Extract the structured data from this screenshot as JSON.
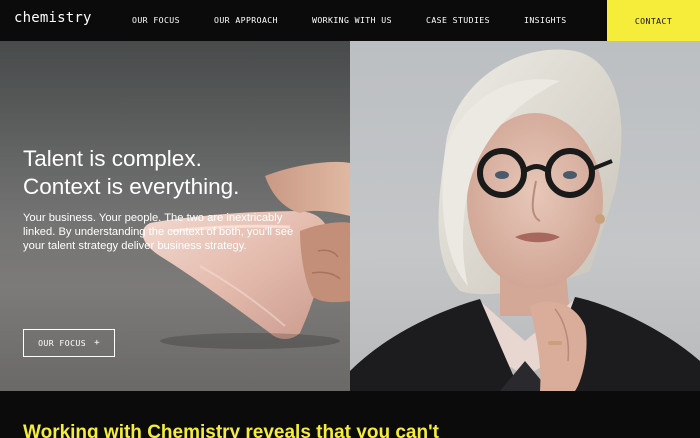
{
  "header": {
    "logo_text": "chemistry",
    "nav": [
      {
        "label": "OUR FOCUS"
      },
      {
        "label": "OUR APPROACH"
      },
      {
        "label": "WORKING WITH US"
      },
      {
        "label": "CASE STUDIES"
      },
      {
        "label": "INSIGHTS"
      }
    ],
    "contact_label": "CONTACT"
  },
  "hero": {
    "title_line1": "Talent is complex.",
    "title_line2": "Context is everything.",
    "body": "Your business. Your people. The two are inextricably linked. By understanding the context of both, you'll see your talent strategy deliver business strategy.",
    "cta_label": "OUR FOCUS",
    "cta_icon": "+"
  },
  "section": {
    "heading": "Working with Chemistry reveals that you can't"
  },
  "colors": {
    "accent": "#f6ed3b",
    "background": "#0b0b0b",
    "text": "#ffffff"
  }
}
